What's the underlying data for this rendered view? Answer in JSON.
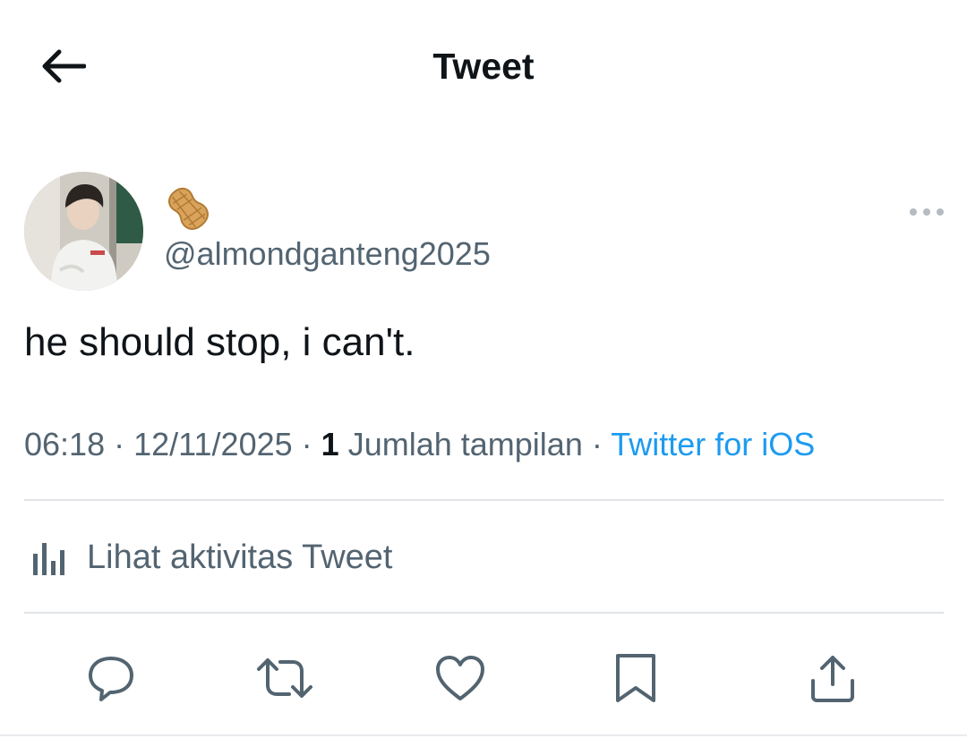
{
  "header": {
    "title": "Tweet",
    "back_icon": "arrow-left-icon"
  },
  "author": {
    "display_name_icon": "peanut-emoji-icon",
    "handle": "@almondganteng2025",
    "avatar_icon": "profile-photo"
  },
  "tweet": {
    "text": "he should stop, i can't."
  },
  "meta": {
    "time": "06:18",
    "separator": "·",
    "date": "12/11/2025",
    "views_count": "1",
    "views_label": "Jumlah tampilan",
    "source": "Twitter for iOS"
  },
  "activity": {
    "label": "Lihat aktivitas Tweet",
    "icon": "bar-chart-icon"
  },
  "actions": [
    {
      "name": "reply",
      "icon": "reply-icon"
    },
    {
      "name": "retweet",
      "icon": "retweet-icon"
    },
    {
      "name": "like",
      "icon": "heart-icon"
    },
    {
      "name": "bookmark",
      "icon": "bookmark-icon"
    },
    {
      "name": "share",
      "icon": "share-icon"
    }
  ],
  "colors": {
    "text_primary": "#0f1419",
    "text_secondary": "#536471",
    "link_blue": "#1d9bf0",
    "divider": "#e1e4e7"
  }
}
